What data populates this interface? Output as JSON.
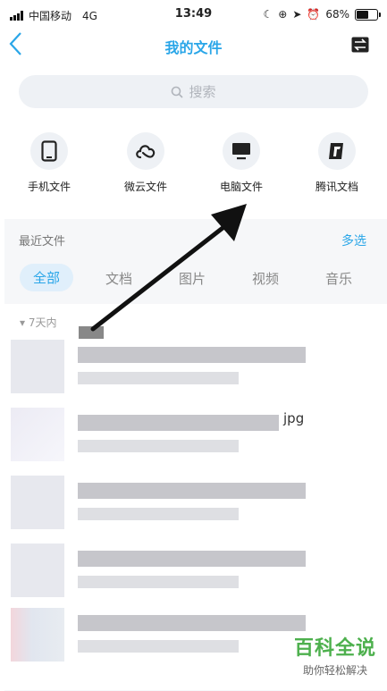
{
  "status_bar": {
    "carrier": "中国移动",
    "network": "4G",
    "time": "13:49",
    "battery_percent": "68%",
    "battery_level": 0.68
  },
  "header": {
    "title": "我的文件"
  },
  "search": {
    "placeholder": "搜索"
  },
  "categories": [
    {
      "label": "手机文件",
      "icon": "phone-icon"
    },
    {
      "label": "微云文件",
      "icon": "cloud-icon"
    },
    {
      "label": "电脑文件",
      "icon": "computer-icon"
    },
    {
      "label": "腾讯文档",
      "icon": "tencent-docs-icon"
    }
  ],
  "recent": {
    "title": "最近文件",
    "multi_select": "多选"
  },
  "tabs": [
    "全部",
    "文档",
    "图片",
    "视频",
    "音乐"
  ],
  "groups": [
    {
      "label": "7天内"
    }
  ],
  "files": [
    {
      "name": "",
      "ext": ""
    },
    {
      "name": "",
      "ext": "jpg"
    },
    {
      "name": "",
      "ext": ""
    },
    {
      "name": "",
      "ext": ""
    },
    {
      "name": "",
      "ext": ""
    }
  ],
  "watermark": {
    "title": "百科全说",
    "subtitle": "助你轻松解决"
  },
  "colors": {
    "accent": "#2aa6e8",
    "watermark": "#4db04d",
    "section_bg": "#f6f7f9"
  }
}
